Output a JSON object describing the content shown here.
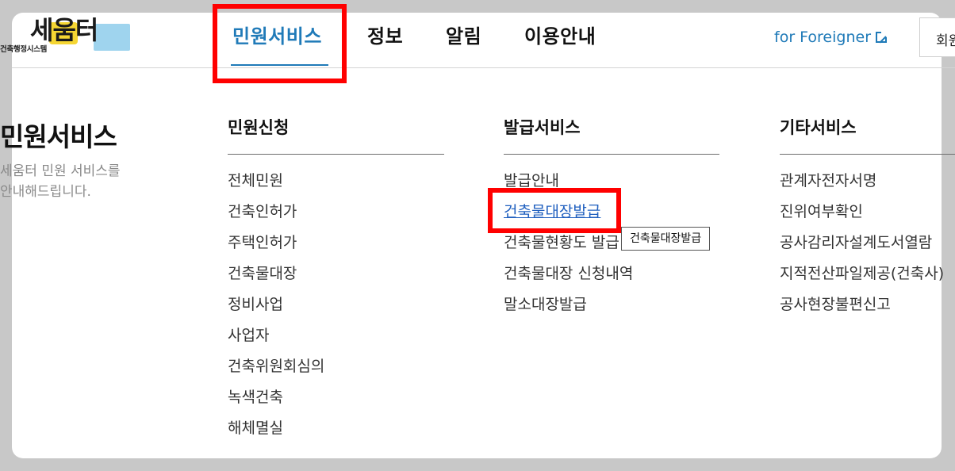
{
  "header": {
    "logo_main": "세움터",
    "logo_sub": "건축행정시스템",
    "nav": [
      {
        "label": "민원서비스",
        "active": true
      },
      {
        "label": "정보",
        "active": false
      },
      {
        "label": "알림",
        "active": false
      },
      {
        "label": "이용안내",
        "active": false
      }
    ],
    "foreigner_link": "for Foreigner",
    "member_button": "회원"
  },
  "menu": {
    "title": "민원서비스",
    "description_line1": "세움터 민원 서비스를",
    "description_line2": "안내해드립니다.",
    "columns": [
      {
        "heading": "민원신청",
        "items": [
          "전체민원",
          "건축인허가",
          "주택인허가",
          "건축물대장",
          "정비사업",
          "사업자",
          "건축위원회심의",
          "녹색건축",
          "해체멸실"
        ]
      },
      {
        "heading": "발급서비스",
        "items": [
          "발급안내",
          "건축물대장발급",
          "건축물현황도 발급",
          "건축물대장 신청내역",
          "말소대장발급"
        ]
      },
      {
        "heading": "기타서비스",
        "items": [
          "관계자전자서명",
          "진위여부확인",
          "공사감리자설계도서열람",
          "지적전산파일제공(건축사)",
          "공사현장불편신고"
        ]
      }
    ],
    "hovered_item": "건축물대장발급",
    "tooltip": "건축물대장발급"
  },
  "colors": {
    "accent": "#1f7ab8",
    "highlight": "#ff0000",
    "link_hover": "#1f5fbf"
  }
}
